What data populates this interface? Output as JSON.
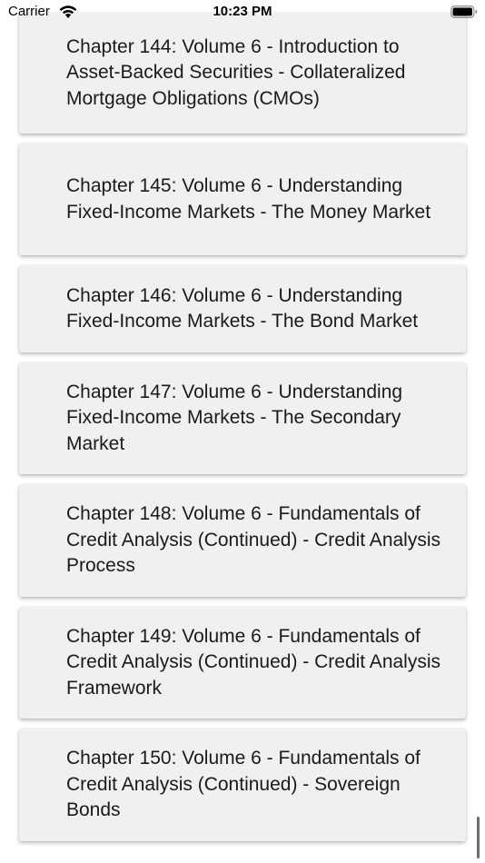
{
  "status_bar": {
    "carrier": "Carrier",
    "time": "10:23 PM"
  },
  "chapters": [
    {
      "title": "Chapter 144: Volume 6 - Introduction to Asset-Backed Securities - Collateralized Mortgage Obligations (CMOs)"
    },
    {
      "title": "Chapter 145: Volume 6 - Understanding Fixed-Income Markets - The Money Market"
    },
    {
      "title": "Chapter 146: Volume 6 - Understanding Fixed-Income Markets - The Bond Market"
    },
    {
      "title": "Chapter 147: Volume 6 - Understanding Fixed-Income Markets - The Secondary Market"
    },
    {
      "title": "Chapter 148: Volume 6 - Fundamentals of Credit Analysis (Continued) - Credit Analysis Process"
    },
    {
      "title": "Chapter 149: Volume 6 - Fundamentals of Credit Analysis (Continued) - Credit Analysis Framework"
    },
    {
      "title": "Chapter 150: Volume 6 - Fundamentals of Credit Analysis (Continued) - Sovereign Bonds"
    }
  ],
  "colors": {
    "card_background": "#f0f0f0",
    "page_background": "#ffffff",
    "text": "#1a1a1a"
  }
}
